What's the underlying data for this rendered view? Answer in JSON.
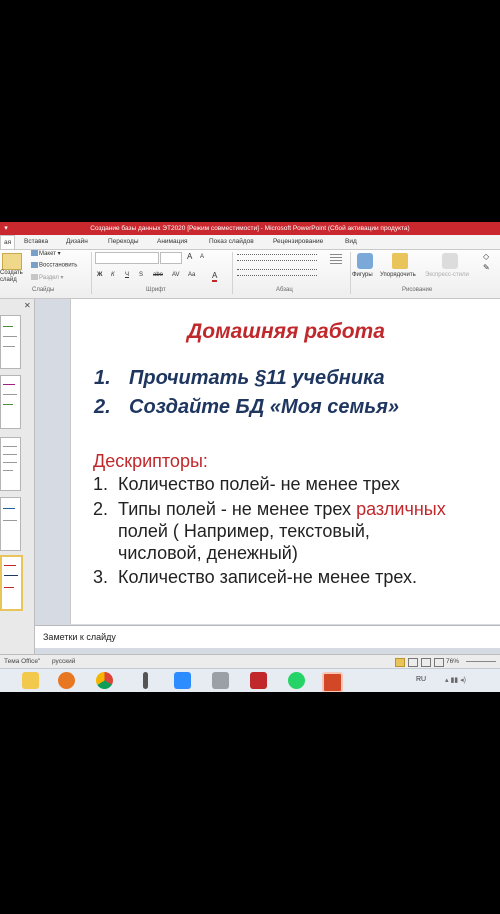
{
  "window": {
    "title": "Создание базы данных ЭТ2020 [Режим совместимости]  -  Microsoft PowerPoint (Сбой активации продукта)"
  },
  "ribbon_tabs": [
    "ая",
    "Вставка",
    "Дизайн",
    "Переходы",
    "Анимация",
    "Показ слайдов",
    "Рецензирование",
    "Вид"
  ],
  "ribbon": {
    "slides": {
      "create_label": "Создать слайд",
      "layout_label": "Макет",
      "restore_label": "Восстановить",
      "section_label": "Раздел",
      "group_label": "Слайды"
    },
    "font": {
      "bold": "Ж",
      "italic": "К",
      "underline": "Ч",
      "strike": "S",
      "abc": "abe",
      "spacing": "AV",
      "case": "Aa",
      "color": "A",
      "grow": "A",
      "shrink": "A",
      "group_label": "Шрифт"
    },
    "paragraph": {
      "group_label": "Абзац"
    },
    "drawing": {
      "shapes_label": "Фигуры",
      "arrange_label": "Упорядочить",
      "quick_styles_label": "Экспресс-стили",
      "group_label": "Рисование"
    }
  },
  "slide": {
    "title": "Домашняя работа",
    "tasks": [
      {
        "num": "1.",
        "text": "Прочитать §11 учебника"
      },
      {
        "num": "2.",
        "text": "Создайте БД «Моя семья»"
      }
    ],
    "descriptors_title": "Дескрипторы:",
    "descriptors": {
      "item1_num": "1.",
      "item1": "Количество полей- не менее трех",
      "item2_num": "2.",
      "item2_a": "Типы полей - не менее трех",
      "item2_highlight": "различных",
      "item2_b": "полей ( Например, текстовый,",
      "item2_c": "числовой, денежный)",
      "item3_num": "3.",
      "item3": "Количество записей-не менее трех."
    }
  },
  "notes": {
    "placeholder": "Заметки к слайду"
  },
  "statusbar": {
    "theme": "Тема Office\"",
    "language": "русский",
    "zoom": "76%"
  },
  "taskbar": {
    "language": "RU"
  },
  "colors": {
    "title_red": "#c0282b",
    "task_blue": "#1f3760",
    "titlebar": "#c8282e"
  }
}
